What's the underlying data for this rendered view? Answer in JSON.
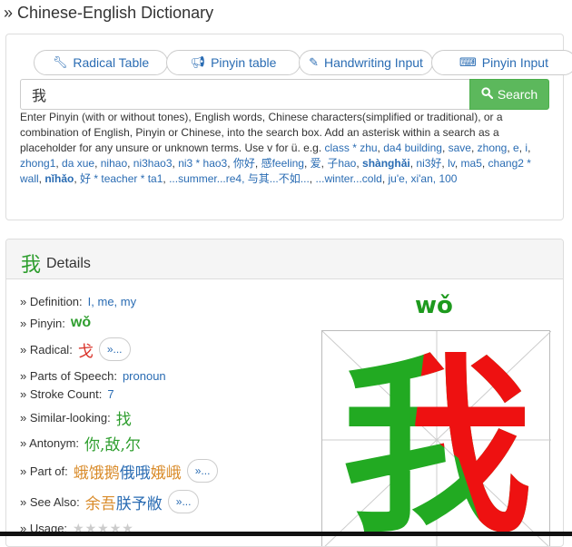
{
  "page": {
    "title": "» Chinese-English Dictionary"
  },
  "tabs": [
    {
      "label": "Radical Table",
      "icon": "wrench-icon"
    },
    {
      "label": "Pinyin table",
      "icon": "bullhorn-icon"
    },
    {
      "label": "Handwriting Input",
      "icon": "pencil-icon"
    },
    {
      "label": "Pinyin Input",
      "icon": "keyboard-icon"
    }
  ],
  "search": {
    "value": "我",
    "button_label": "Search"
  },
  "help": {
    "intro": "Enter Pinyin (with or without tones), English words, Chinese characters(simplified or traditional), or a combination of English, Pinyin or Chinese, into the search box. Add an asterisk within a search as a placeholder for any unsure or unknown terms. Use v for ü. e.g.",
    "examples": [
      "class * zhu",
      "da4 building",
      "save",
      "zhong",
      "e",
      "i",
      "zhong1",
      "da xue",
      "nihao",
      "ni3hao3",
      "ni3 * hao3",
      "你好",
      "感feeling",
      "爱",
      "子hao",
      "shànghǎi",
      "ni3好",
      "lv",
      "ma5",
      "chang2 * wall",
      "nǐhǎo",
      "好 * teacher * ta1",
      "...summer...re4, 与其...不如...",
      "...winter...cold",
      "ju'e, xi'an, 100"
    ]
  },
  "details": {
    "char": "我",
    "title": "Details",
    "definition_label": "» Definition:",
    "definition": "I, me, my",
    "pinyin_label": "» Pinyin:",
    "pinyin": "wǒ",
    "radical_label": "» Radical:",
    "radical": "戈",
    "more_label": "»...",
    "pos_label": "» Parts of Speech:",
    "pos": "pronoun",
    "stroke_label": "» Stroke Count:",
    "stroke_count": "7",
    "similar_label": "» Similar-looking:",
    "similar": "找",
    "antonym_label": "» Antonym:",
    "antonyms": [
      "你",
      ",",
      "敌",
      ",",
      "尔"
    ],
    "partof_label": "» Part of:",
    "partof": [
      "蛾",
      "饿",
      "鹅",
      "俄",
      "哦",
      "娥",
      "峨"
    ],
    "seealso_label": "» See Also:",
    "seealso": [
      "余",
      "吾",
      "朕",
      "予",
      "敝"
    ],
    "usage_label": "» Usage:",
    "usage_stars": 0
  },
  "colors": {
    "accent": "#2a6cb3",
    "search_green": "#5cb85c",
    "char_green": "#2e9e2e"
  }
}
